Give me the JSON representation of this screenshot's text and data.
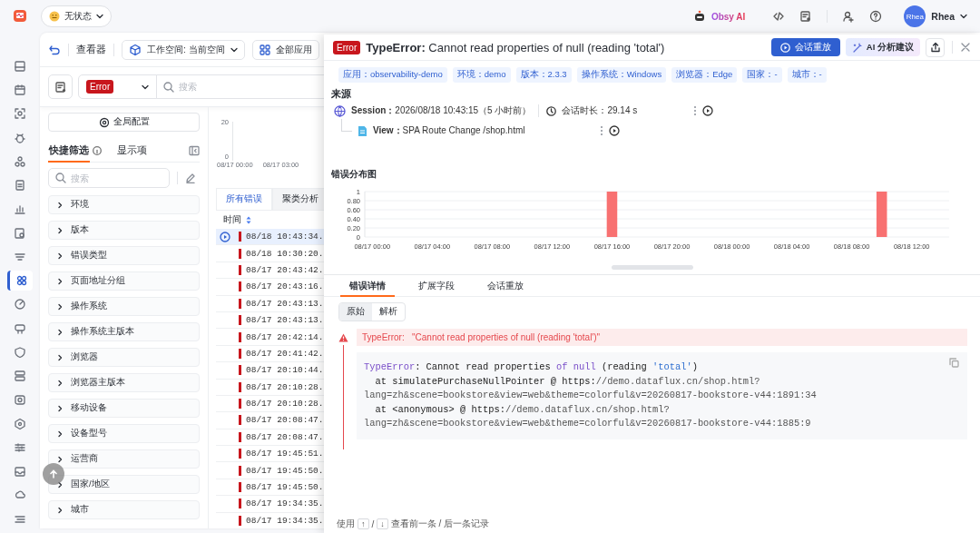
{
  "top_bar": {
    "status": "无状态",
    "ai_label": "Obsy AI",
    "avatar": "Rhea",
    "user_name": "Rhea"
  },
  "nav_rail": {
    "items": [
      {
        "selected": false
      },
      {
        "selected": false
      },
      {
        "selected": false
      },
      {
        "selected": false
      },
      {
        "selected": false
      },
      {
        "selected": false
      },
      {
        "selected": false
      },
      {
        "selected": false
      },
      {
        "selected": false
      },
      {
        "selected": true
      },
      {
        "selected": false
      },
      {
        "selected": false
      },
      {
        "selected": false
      },
      {
        "selected": false
      },
      {
        "selected": false
      },
      {
        "selected": false
      },
      {
        "selected": false
      },
      {
        "selected": false
      },
      {
        "selected": false
      },
      {
        "selected": false
      }
    ]
  },
  "viewer": {
    "title": "查看器",
    "workspace": "工作空间: 当前空间",
    "apps": "全部应用",
    "level_filter": "Error",
    "search": {
      "placeholder": "搜索"
    }
  },
  "filter_panel": {
    "global_config": "全局配置",
    "tabs": [
      {
        "label": "快捷筛选",
        "selected": true
      },
      {
        "label": "显示项",
        "selected": false
      }
    ],
    "search": {
      "placeholder": "搜索"
    },
    "facets": [
      {
        "label": "环境",
        "expanded": false
      },
      {
        "label": "版本",
        "expanded": false
      },
      {
        "label": "错误类型",
        "expanded": false
      },
      {
        "label": "页面地址分组",
        "expanded": false
      },
      {
        "label": "操作系统",
        "expanded": false
      },
      {
        "label": "操作系统主版本",
        "expanded": false
      },
      {
        "label": "浏览器",
        "expanded": false
      },
      {
        "label": "浏览器主版本",
        "expanded": false
      },
      {
        "label": "移动设备",
        "expanded": false
      },
      {
        "label": "设备型号",
        "expanded": false
      },
      {
        "label": "运营商",
        "expanded": false
      },
      {
        "label": "国家/地区",
        "expanded": false
      },
      {
        "label": "城市",
        "expanded": false
      }
    ]
  },
  "error_list": {
    "mini_chart": {
      "yticks": [
        "20",
        "0"
      ],
      "xticks": [
        "08/17 00:00",
        "08/17 03:00"
      ]
    },
    "tabs": [
      {
        "label": "所有错误",
        "selected": true
      },
      {
        "label": "聚类分析",
        "selected": false
      }
    ],
    "column": "时间",
    "rows": [
      {
        "time": "08/18 10:43:34.",
        "selected": true
      },
      {
        "time": "08/18 10:30:20.",
        "selected": false
      },
      {
        "time": "08/17 20:43:42.",
        "selected": false
      },
      {
        "time": "08/17 20:43:16.",
        "selected": false
      },
      {
        "time": "08/17 20:43:13.",
        "selected": false
      },
      {
        "time": "08/17 20:43:13.",
        "selected": false
      },
      {
        "time": "08/17 20:42:14.",
        "selected": false
      },
      {
        "time": "08/17 20:41:42.",
        "selected": false
      },
      {
        "time": "08/17 20:10:44.",
        "selected": false
      },
      {
        "time": "08/17 20:10:28.",
        "selected": false
      },
      {
        "time": "08/17 20:10:28.",
        "selected": false
      },
      {
        "time": "08/17 20:08:47.",
        "selected": false
      },
      {
        "time": "08/17 20:08:47.",
        "selected": false
      },
      {
        "time": "08/17 19:45:51.",
        "selected": false
      },
      {
        "time": "08/17 19:45:50.",
        "selected": false
      },
      {
        "time": "08/17 19:45:50.",
        "selected": false
      },
      {
        "time": "08/17 19:34:35.",
        "selected": false
      },
      {
        "time": "08/17 19:34:35.",
        "selected": false
      }
    ]
  },
  "drawer": {
    "level": "Error",
    "title": "**TypeError:** Cannot read properties of null (reading 'total')",
    "replay_button": "会话重放",
    "ai_button": "AI 分析建议",
    "tags": [
      "应用：observability-demo",
      "环境：demo",
      "版本：2.3.3",
      "操作系统：Windows",
      "浏览器：Edge",
      "国家：-",
      "城市：-"
    ],
    "source": {
      "heading": "来源",
      "session": "**Session：**2026/08/18 10:43:15（5 小时前）",
      "duration": "会话时长：29.14 s",
      "view": "**View：**SPA Route Change /shop.html"
    },
    "distribution": {
      "title": "错误分布图",
      "chart_data": {
        "type": "bar",
        "categories": [
          "08/17 00:00",
          null,
          null,
          null,
          "08/17 04:00",
          null,
          null,
          null,
          "08/17 08:00",
          null,
          null,
          null,
          "08/17 12:00",
          null,
          null,
          null,
          "08/17 16:00",
          null,
          null,
          null,
          "08/17 20:00",
          null,
          null,
          null,
          "08/18 00:00",
          null,
          null,
          null,
          "08/18 04:00",
          null,
          null,
          null,
          "08/18 08:00",
          null,
          null,
          null,
          "08/18 12:00",
          null,
          null
        ],
        "values": [
          0,
          0,
          0,
          0,
          0,
          0,
          0,
          0,
          0,
          0,
          0,
          0,
          0,
          0,
          0,
          0,
          1,
          0,
          0,
          0,
          0,
          0,
          0,
          0,
          0,
          0,
          0,
          0,
          0,
          0,
          0,
          0,
          0,
          0,
          1,
          0,
          0,
          0,
          0
        ],
        "ylim": [
          0,
          1
        ],
        "grid": true,
        "yticks": [
          0,
          {
            "value": 0.2,
            "label": "0.20"
          },
          {
            "value": 0.4,
            "label": "0.40"
          },
          {
            "value": 0.6,
            "label": "0.60"
          },
          {
            "value": 0.8,
            "label": "0.80"
          },
          1
        ]
      }
    },
    "detail_tabs": [
      {
        "label": "错误详情",
        "selected": true
      },
      {
        "label": "扩展字段",
        "selected": false
      },
      {
        "label": "会话重放",
        "selected": false
      }
    ],
    "modes": [
      {
        "label": "原始",
        "selected": true
      },
      {
        "label": "解析",
        "selected": false
      }
    ],
    "error_banner": "TypeError:   \"Cannot read properties of null (reading 'total')\"",
    "stack": [
      [
        {
          "kind": "keyword",
          "text": "TypeError"
        },
        {
          "kind": "plain",
          "text": ": Cannot read properties "
        },
        {
          "kind": "keyword",
          "text": "of null"
        },
        {
          "kind": "plain",
          "text": " (reading "
        },
        {
          "kind": "string",
          "text": "'total'"
        },
        {
          "kind": "plain",
          "text": ")"
        }
      ],
      [
        {
          "kind": "plain",
          "text": "  at simulatePurchaseNullPointer @ https:"
        },
        {
          "kind": "muted",
          "text": "//demo.dataflux.cn/shop.html?"
        }
      ],
      [
        {
          "kind": "muted",
          "text": "lang=zh&scene=bookstore&view=web&theme=colorful&v=20260817-bookstore-v44:1891:34"
        }
      ],
      [
        {
          "kind": "plain",
          "text": "  at <anonymous> @ https:"
        },
        {
          "kind": "muted",
          "text": "//demo.dataflux.cn/shop.html?"
        }
      ],
      [
        {
          "kind": "muted",
          "text": "lang=zh&scene=bookstore&view=web&theme=colorful&v=20260817-bookstore-v44:1885:9"
        }
      ]
    ],
    "footer": {
      "prefix": "使用",
      "up_key": "↑",
      "separator": "/",
      "down_key": "↓",
      "hint": "查看前一条 / 后一条记录"
    }
  }
}
